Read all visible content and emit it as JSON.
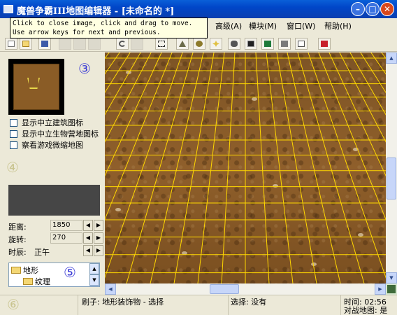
{
  "window": {
    "title": "魔兽争霸III地图编辑器 - [未命名的 *]",
    "minimize_glyph": "–",
    "maximize_glyph": "□",
    "close_glyph": "✕"
  },
  "menu": {
    "items": [
      {
        "label": "高级(A)"
      },
      {
        "label": "模块(M)"
      },
      {
        "label": "窗口(W)"
      },
      {
        "label": "帮助(H)"
      }
    ]
  },
  "tooltip": {
    "line1": "Click to close image, click and drag to move.",
    "line2": "Use arrow keys for next and previous."
  },
  "toolbar": {
    "icons": [
      "new-icon",
      "open-icon",
      "save-icon",
      "cut-icon",
      "copy-icon",
      "paste-icon",
      "undo-icon",
      "redo-icon",
      "select-icon",
      "terrain-palette-icon",
      "doodad-palette-icon",
      "unit-palette-icon",
      "region-palette-icon",
      "camera-palette-icon",
      "trigger-editor-icon",
      "sound-editor-icon",
      "object-editor-icon",
      "campaign-editor-icon",
      "ai-editor-icon",
      "object-manager-icon",
      "test-map-icon"
    ]
  },
  "annotations": {
    "n3": "③",
    "n4": "④",
    "n5": "⑤",
    "n6": "⑥"
  },
  "left_panel": {
    "checkboxes": [
      {
        "label": "显示中立建筑图标",
        "checked": false
      },
      {
        "label": "显示中立生物营地图标",
        "checked": false
      },
      {
        "label": "察看游戏微缩地图",
        "checked": false
      }
    ],
    "distance_label": "距离:",
    "distance_value": "1850",
    "rotation_label": "旋转:",
    "rotation_value": "270",
    "time_label": "时辰:",
    "time_value": "正午",
    "spin_left": "◀",
    "spin_right": "▶",
    "tree": {
      "root": "地形",
      "child": "纹理",
      "up": "▲",
      "down": "▼"
    }
  },
  "scrollbar": {
    "up": "▲",
    "down": "▼",
    "left": "◀",
    "right": "▶"
  },
  "status": {
    "brush": "刷子: 地形装饰物 - 选择",
    "selection": "选择: 没有",
    "time": "时间: 02:56",
    "melee": "对战地图: 是"
  },
  "colors": {
    "grid": "#ffd800",
    "dirt": "#86592a",
    "title_bar": "#0a5fd8",
    "annotation": "#3b3bd6",
    "annotation_faded": "#c9c48f"
  }
}
